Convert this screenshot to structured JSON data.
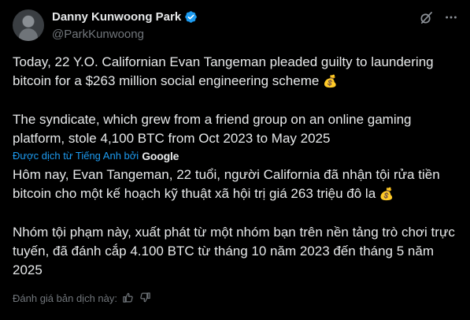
{
  "author": {
    "name": "Danny Kunwoong Park",
    "handle": "@ParkKunwoong",
    "verified": true,
    "verified_color": "#1d9bf0"
  },
  "icons": {
    "verified": "verified-badge-icon",
    "grok": "grok-icon",
    "more": "more-options-icon",
    "money_bag": "money-bag-emoji",
    "thumbs_up": "thumbs-up-icon",
    "thumbs_down": "thumbs-down-icon"
  },
  "tweet": {
    "original": [
      "Today, 22 Y.O. Californian Evan Tangeman pleaded guilty to laundering bitcoin for a $263 million social engineering scheme",
      "The syndicate, which grew from a friend group on an online gaming platform, stole 4,100 BTC from Oct 2023 to May 2025"
    ],
    "translated_by_label": "Được dịch từ Tiếng Anh bởi",
    "translator": "Google",
    "translation": [
      "Hôm nay, Evan Tangeman, 22 tuổi, người California đã nhận tội rửa tiền bitcoin cho một kế hoạch kỹ thuật xã hội trị giá 263 triệu đô la",
      "Nhóm tội phạm này, xuất phát từ một nhóm bạn trên nền tảng trò chơi trực tuyến, đã đánh cắp 4.100 BTC từ tháng 10 năm 2023 đến tháng 5 năm 2025"
    ],
    "emoji": "💰"
  },
  "rating": {
    "label": "Đánh giá bản dịch này:"
  },
  "colors": {
    "background": "#000000",
    "text": "#e7e9ea",
    "muted": "#71767b",
    "accent": "#1d9bf0"
  }
}
